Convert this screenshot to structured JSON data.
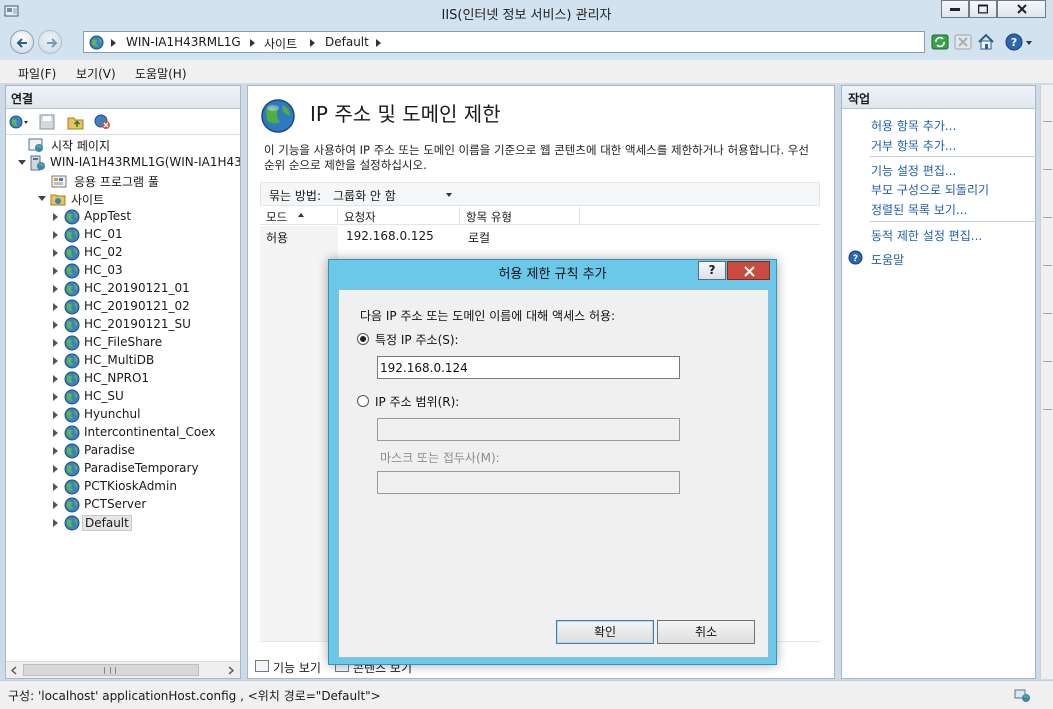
{
  "window": {
    "title": "IIS(인터넷 정보 서비스) 관리자"
  },
  "address": {
    "crumbs": [
      "WIN-IA1H43RML1G",
      "사이트",
      "Default"
    ]
  },
  "menu": {
    "items": [
      "파일(F)",
      "보기(V)",
      "도움말(H)"
    ]
  },
  "connections": {
    "header": "연결",
    "tree": {
      "start_page": "시작 페이지",
      "server": "WIN-IA1H43RML1G(WIN-IA1H43RML1G",
      "app_pools": "응용 프로그램 풀",
      "sites": "사이트",
      "site_list": [
        "AppTest",
        "HC_01",
        "HC_02",
        "HC_03",
        "HC_20190121_01",
        "HC_20190121_02",
        "HC_20190121_SU",
        "HC_FileShare",
        "HC_MultiDB",
        "HC_NPRO1",
        "HC_SU",
        "Hyunchul",
        "Intercontinental_Coex",
        "Paradise",
        "ParadiseTemporary",
        "PCTKioskAdmin",
        "PCTServer",
        "Default"
      ]
    }
  },
  "center": {
    "title": "IP 주소 및 도메인 제한",
    "description": "이 기능을 사용하여 IP 주소 또는 도메인 이름을 기준으로 웹 콘텐츠에 대한 액세스를 제한하거나 허용합니다. 우선 순위 순으로 제한을 설정하십시오.",
    "group_by_label": "묶는 방법:",
    "group_by_value": "그룹화 안 함",
    "columns": [
      "모드",
      "요청자",
      "항목 유형"
    ],
    "rows": [
      {
        "mode": "허용",
        "requester": "192.168.0.125",
        "entry_type": "로컬"
      }
    ],
    "view_tabs": [
      "기능 보기",
      "콘텐츠 보기"
    ]
  },
  "actions": {
    "header": "작업",
    "items": [
      "허용 항목 추가...",
      "거부 항목 추가...",
      "기능 설정 편집...",
      "부모 구성으로 되돌리기",
      "정렬된 목록 보기...",
      "동적 제한 설정 편집...",
      "도움말"
    ]
  },
  "status": {
    "text": "구성: 'localhost' applicationHost.config , <위치 경로=\"Default\">"
  },
  "dialog": {
    "title": "허용 제한 규칙 추가",
    "help_label": "?",
    "prompt": "다음 IP 주소 또는 도메인 이름에 대해 액세스 허용:",
    "radio_specific": "특정 IP 주소(S):",
    "specific_value": "192.168.0.124",
    "radio_range": "IP 주소 범위(R):",
    "range_value": "",
    "mask_label": "마스크 또는 접두사(M):",
    "mask_value": "",
    "ok_label": "확인",
    "cancel_label": "취소"
  },
  "colors": {
    "dialog_frame": "#6cc8e9",
    "close_red": "#c94a3f",
    "link_blue": "#1f5fb0"
  },
  "icons": [
    "app-icon",
    "back-arrow-icon",
    "forward-arrow-icon",
    "globe-icon",
    "refresh-icon",
    "stop-icon",
    "home-icon",
    "help-icon",
    "folder-icon",
    "server-icon",
    "site-globe-icon"
  ]
}
